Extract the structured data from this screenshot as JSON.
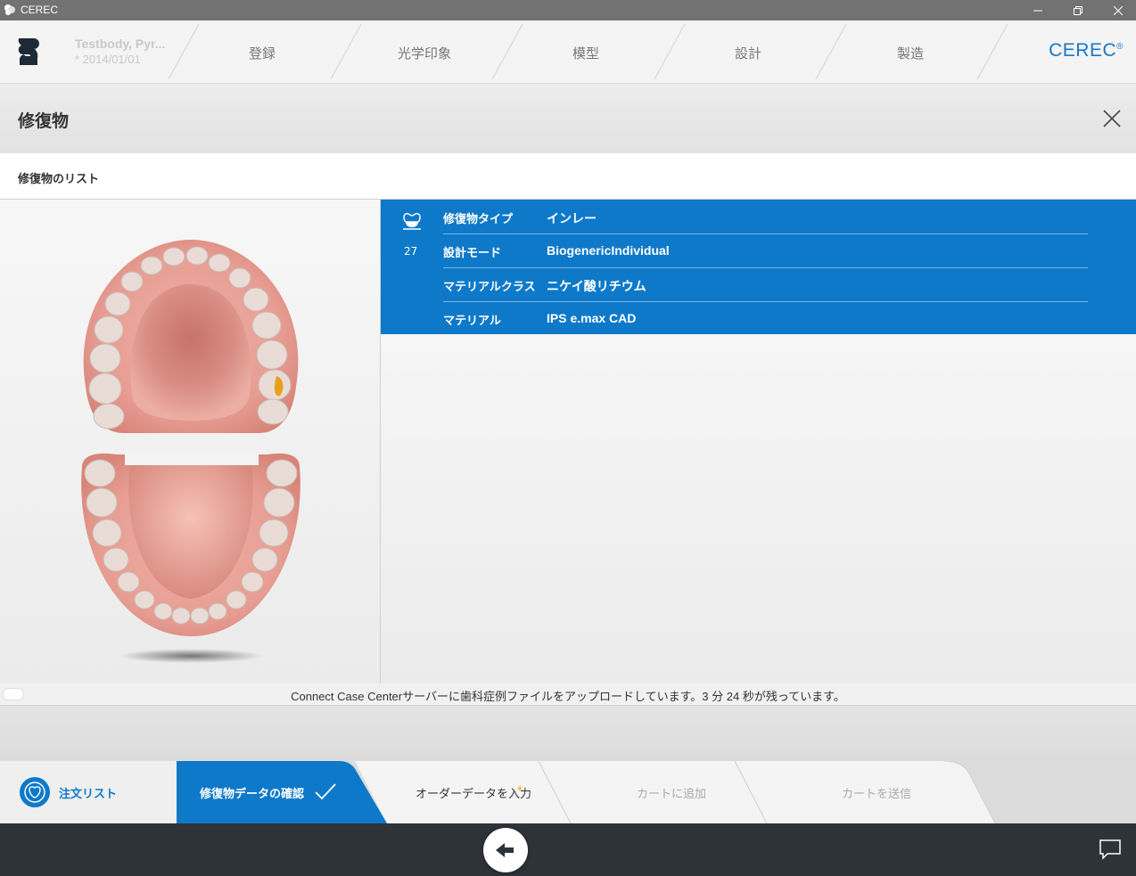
{
  "window": {
    "title": "CEREC",
    "controls": {
      "minimize": "minimize-icon",
      "restore": "restore-icon",
      "close": "close-icon"
    }
  },
  "header": {
    "patient_name": "Testbody, Pyr...",
    "patient_date": "* 2014/01/01",
    "steps": [
      "登録",
      "光学印象",
      "模型",
      "設計",
      "製造"
    ],
    "brand": "CEREC",
    "brand_mark": "®"
  },
  "page": {
    "title": "修復物",
    "section_title": "修復物のリスト"
  },
  "restoration": {
    "icon": "inlay-tooth-icon",
    "tooth_number": "27",
    "properties": [
      {
        "label": "修復物タイプ",
        "value": "インレー"
      },
      {
        "label": "設計モード",
        "value": "BiogenericIndividual"
      },
      {
        "label": "マテリアルクラス",
        "value": "ニケイ酸リチウム"
      },
      {
        "label": "マテリアル",
        "value": "IPS e.max CAD"
      }
    ]
  },
  "status": {
    "message": "Connect Case Centerサーバーに歯科症例ファイルをアップロードしています。3 分 24 秒が残っています。"
  },
  "wizard": {
    "steps": [
      {
        "label": "注文リスト",
        "state": "link"
      },
      {
        "label": "修復物データの確認",
        "state": "active"
      },
      {
        "label": "オーダーデータを入力",
        "state": "pending",
        "required_mark": "*"
      },
      {
        "label": "カートに追加",
        "state": "disabled"
      },
      {
        "label": "カートを送信",
        "state": "disabled"
      }
    ]
  },
  "colors": {
    "accent": "#0e79c9",
    "brand": "#1877c5",
    "titlebar": "#727272",
    "bottombar": "#2e3239",
    "required_star": "#f0a500"
  }
}
